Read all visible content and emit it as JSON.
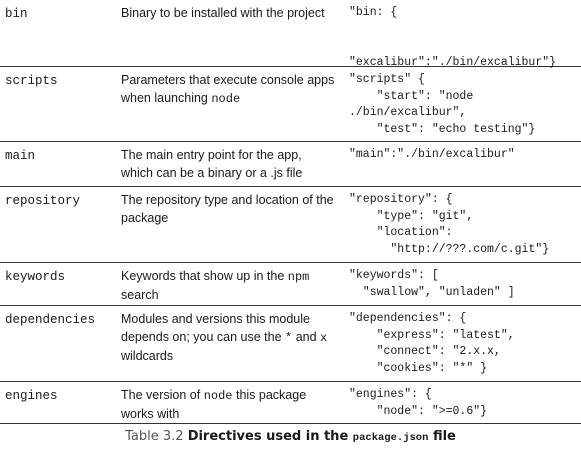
{
  "rows": [
    {
      "name": "bin",
      "desc_parts": [
        {
          "text": "Binary to be installed with the project",
          "mono": false
        }
      ],
      "example": "\"bin: {\n\n\n\"excalibur\":\"./bin/excalibur\"}"
    },
    {
      "name": "scripts",
      "desc_parts": [
        {
          "text": "Parameters that execute console apps when launching ",
          "mono": false
        },
        {
          "text": "node",
          "mono": true
        }
      ],
      "example": "\"scripts\" {\n    \"start\": \"node\n./bin/excalibur\",\n    \"test\": \"echo testing\"}"
    },
    {
      "name": "main",
      "desc_parts": [
        {
          "text": "The main entry point for the app, which can be a binary or a .js file",
          "mono": false
        }
      ],
      "example": "\"main\":\"./bin/excalibur\""
    },
    {
      "name": "repository",
      "desc_parts": [
        {
          "text": "The repository type and location of the package",
          "mono": false
        }
      ],
      "example": "\"repository\": {\n    \"type\": \"git\",\n    \"location\":\n      \"http://???.com/c.git\"}"
    },
    {
      "name": "keywords",
      "desc_parts": [
        {
          "text": "Keywords that show up in the ",
          "mono": false
        },
        {
          "text": "npm",
          "mono": true
        },
        {
          "text": " search",
          "mono": false
        }
      ],
      "example": "\"keywords\": [\n  \"swallow\", \"unladen\" ]"
    },
    {
      "name": "dependencies",
      "desc_parts": [
        {
          "text": "Modules and versions this module depends on; you can use the ",
          "mono": false
        },
        {
          "text": "*",
          "mono": true
        },
        {
          "text": " and ",
          "mono": false
        },
        {
          "text": "x",
          "mono": true
        },
        {
          "text": " wildcards",
          "mono": false
        }
      ],
      "example": "\"dependencies\": {\n    \"express\": \"latest\",\n    \"connect\": \"2.x.x,\n    \"cookies\": \"*\" }"
    },
    {
      "name": "engines",
      "desc_parts": [
        {
          "text": "The version of ",
          "mono": false
        },
        {
          "text": "node",
          "mono": true
        },
        {
          "text": " this package works with",
          "mono": false
        }
      ],
      "example": "\"engines\": {\n    \"node\": \">=0.6\"}"
    }
  ],
  "caption": {
    "label": "Table 3.2",
    "title_a": "Directives used in the",
    "title_code": "package.json",
    "title_b": "file"
  }
}
